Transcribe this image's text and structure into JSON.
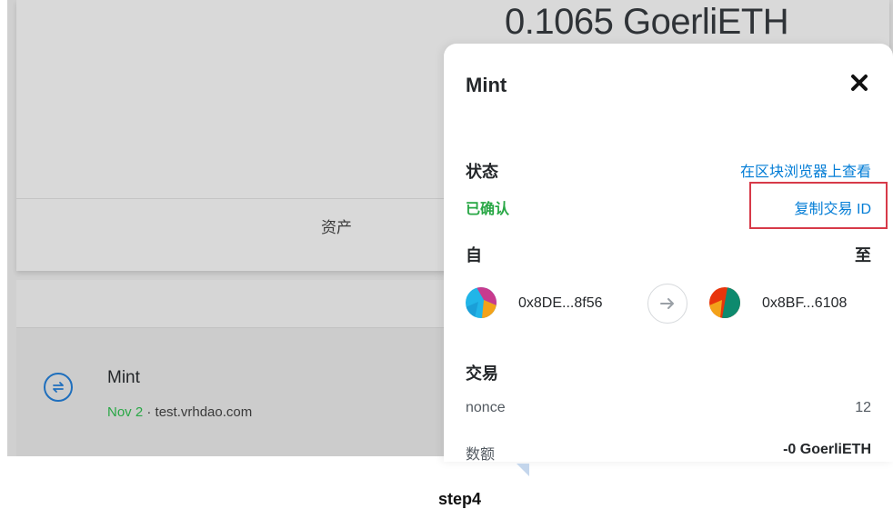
{
  "background": {
    "balance": "0.1065 GoerliETH",
    "tab_assets": "资产",
    "activity": {
      "icon": "swap-arrows-icon",
      "title": "Mint",
      "date": "Nov 2",
      "separator": " · ",
      "origin": "test.vrhdao.com"
    }
  },
  "modal": {
    "title": "Mint",
    "close_icon": "close-icon",
    "status_label": "状态",
    "view_on_explorer": "在区块浏览器上查看",
    "status_value": "已确认",
    "copy_tx_id": "复制交易 ID",
    "from_label": "自",
    "to_label": "至",
    "from_address": "0x8DE...8f56",
    "to_address": "0x8BF...6108",
    "transaction_label": "交易",
    "rows": [
      {
        "key": "nonce",
        "value": "12"
      },
      {
        "key": "数额",
        "value": "-0 GoerliETH"
      }
    ]
  },
  "caption": "step4",
  "colors": {
    "link": "#037dd6",
    "success": "#28a745",
    "highlight_border": "#d73a49"
  }
}
